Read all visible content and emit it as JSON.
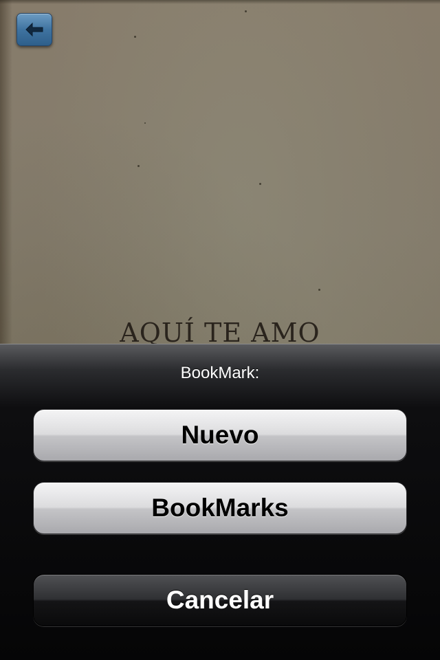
{
  "book": {
    "title": "AQUÍ TE AMO"
  },
  "toolbar": {
    "back_icon": "back-arrow-icon",
    "accent": "#3f73a0"
  },
  "action_sheet": {
    "title": "BookMark:",
    "buttons": [
      {
        "label": "Nuevo",
        "style": "light"
      },
      {
        "label": "BookMarks",
        "style": "light"
      },
      {
        "label": "Cancelar",
        "style": "dark"
      }
    ]
  }
}
